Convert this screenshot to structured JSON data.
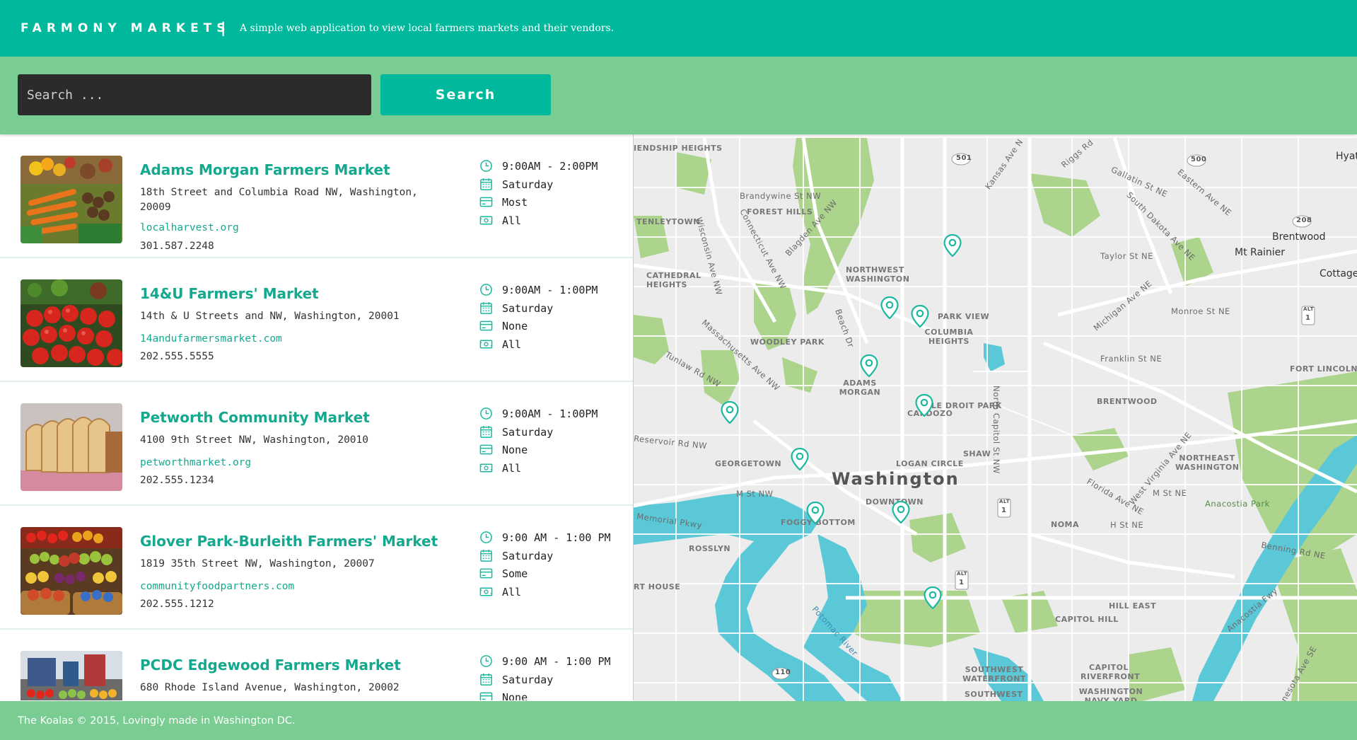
{
  "header": {
    "brand": "FARMONY MARKETS",
    "separator": "|",
    "tagline": "A simple web application to view local farmers markets and their vendors."
  },
  "search": {
    "placeholder": "Search ...",
    "button_label": "Search"
  },
  "markets": [
    {
      "name": "Adams Morgan Farmers Market",
      "address": "18th Street and Columbia Road NW, Washington, 20009",
      "website": "localharvest.org",
      "phone": "301.587.2248",
      "hours": "9:00AM - 2:00PM",
      "day": "Saturday",
      "payment": "Most",
      "season": "All",
      "image": "vegetables-image"
    },
    {
      "name": "14&U Farmers' Market",
      "address": "14th & U Streets and NW, Washington, 20001",
      "website": "14andufarmersmarket.com",
      "phone": "202.555.5555",
      "hours": "9:00AM - 1:00PM",
      "day": "Saturday",
      "payment": "None",
      "season": "All",
      "image": "tomatoes-image"
    },
    {
      "name": "Petworth Community Market",
      "address": "4100 9th Street NW, Washington, 20010",
      "website": "petworthmarket.org",
      "phone": "202.555.1234",
      "hours": "9:00AM - 1:00PM",
      "day": "Saturday",
      "payment": "None",
      "season": "All",
      "image": "bread-image"
    },
    {
      "name": "Glover Park-Burleith Farmers' Market",
      "address": "1819 35th Street NW, Washington, 20007",
      "website": "communityfoodpartners.com",
      "phone": "202.555.1212",
      "hours": "9:00 AM - 1:00 PM",
      "day": "Saturday",
      "payment": "Some",
      "season": "All",
      "image": "produce-baskets-image"
    },
    {
      "name": "PCDC Edgewood Farmers Market",
      "address": "680 Rhode Island Avenue, Washington, 20002",
      "website": "",
      "phone": "",
      "hours": "9:00 AM - 1:00 PM",
      "day": "Saturday",
      "payment": "None",
      "season": "",
      "image": "market-stall-image"
    }
  ],
  "map": {
    "city": "Washington",
    "labels": {
      "friendship_heights": "IENDSHIP HEIGHTS",
      "tenleytown": "TENLEYTOWN",
      "forest_hills": "FOREST HILLS",
      "cathedral_heights": "CATHEDRAL HEIGHTS",
      "northwest_washington": "NORTHWEST WASHINGTON",
      "woodley_park": "WOODLEY PARK",
      "adams_morgan": "ADAMS MORGAN",
      "columbia_heights": "COLUMBIA HEIGHTS",
      "park_view": "PARK VIEW",
      "le_droit_park": "LE DROIT PARK",
      "cardozo": "CARDOZO",
      "shaw": "SHAW",
      "logan_circle": "LOGAN CIRCLE",
      "georgetown": "GEORGETOWN",
      "downtown": "DOWNTOWN",
      "foggy_bottom": "FOGGY BOTTOM",
      "rosslyn": "ROSSLYN",
      "noma": "NOMA",
      "brentwood": "BRENTWOOD",
      "brentwood_city": "Brentwood",
      "mt_rainier": "Mt Rainier",
      "cottage": "Cottage",
      "hyattsville": "Hyat",
      "fort_lincoln": "FORT LINCOLN",
      "northeast_washington": "NORTHEAST WASHINGTON",
      "hill_east": "HILL EAST",
      "capitol_hill": "CAPITOL HILL",
      "capitol_riverfront": "CAPITOL RIVERFRONT",
      "southwest_waterfront": "SOUTHWEST WATERFRONT",
      "southwest": "SOUTHWEST",
      "washington_navy_yard": "WASHINGTON NAVY YARD",
      "anacostia_park": "Anacostia Park",
      "potomac_river": "Potomac River",
      "memorial_pkwy": "Memorial Pkwy",
      "arlington_house": "RT HOUSE",
      "reservoir_rd": "Reservoir Rd NW",
      "m_st_nw": "M St NW",
      "m_st_ne": "M St NE",
      "h_st_ne": "H St NE",
      "benning_rd": "Benning Rd NE",
      "florida_ave": "Florida Ave NE",
      "west_virginia_ave": "West Virginia Ave NE",
      "franklin_st": "Franklin St NE",
      "monroe_st": "Monroe St NE",
      "taylor_st": "Taylor St NE",
      "gallatin_st": "Gallatin St NE",
      "eastern_ave": "Eastern Ave NE",
      "south_dakota_ave": "South Dakota Ave NE",
      "michigan_ave": "Michigan Ave NE",
      "kansas_ave": "Kansas Ave N",
      "riggs_rd": "Riggs Rd",
      "brandywine_st": "Brandywine St NW",
      "connecticut_ave": "Connecticut Ave NW",
      "wisconsin_ave": "Wisconsin Ave NW",
      "massachusetts_ave": "Massachusetts Ave NW",
      "tunlaw_rd": "Tunlaw Rd NW",
      "beach_dr": "Beach Dr",
      "blagden_ave": "Blagden Ave NW",
      "north_capitol": "North Capitol St NW",
      "minnesota_ave": "Minnesota Ave SE",
      "anacostia_fwy": "Anacostia Fwy",
      "route_501": "501",
      "route_500": "500",
      "route_208": "208",
      "route_110": "110",
      "alt_1": "1",
      "alt_label": "ALT"
    }
  },
  "footer": {
    "text": "The Koalas © 2015, Lovingly made in Washington DC."
  },
  "colors": {
    "header": "#00b89c",
    "searchbar": "#79cc92",
    "accent_text": "#14a98f",
    "map_water": "#5bc8d8",
    "map_park": "#a9d18e",
    "pin": "#1bb8a0"
  }
}
